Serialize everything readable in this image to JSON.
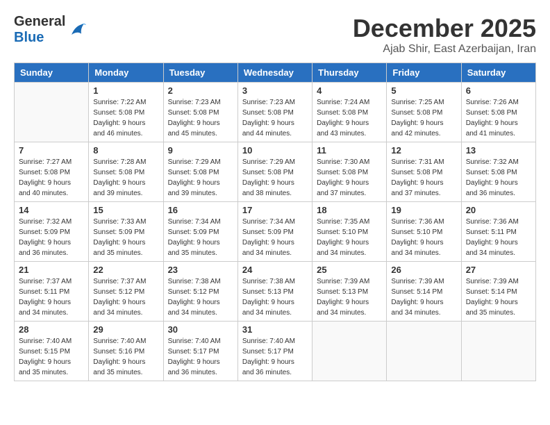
{
  "header": {
    "logo_line1": "General",
    "logo_line2": "Blue",
    "month_title": "December 2025",
    "subtitle": "Ajab Shir, East Azerbaijan, Iran"
  },
  "columns": [
    "Sunday",
    "Monday",
    "Tuesday",
    "Wednesday",
    "Thursday",
    "Friday",
    "Saturday"
  ],
  "weeks": [
    [
      {
        "day": "",
        "info": ""
      },
      {
        "day": "1",
        "info": "Sunrise: 7:22 AM\nSunset: 5:08 PM\nDaylight: 9 hours\nand 46 minutes."
      },
      {
        "day": "2",
        "info": "Sunrise: 7:23 AM\nSunset: 5:08 PM\nDaylight: 9 hours\nand 45 minutes."
      },
      {
        "day": "3",
        "info": "Sunrise: 7:23 AM\nSunset: 5:08 PM\nDaylight: 9 hours\nand 44 minutes."
      },
      {
        "day": "4",
        "info": "Sunrise: 7:24 AM\nSunset: 5:08 PM\nDaylight: 9 hours\nand 43 minutes."
      },
      {
        "day": "5",
        "info": "Sunrise: 7:25 AM\nSunset: 5:08 PM\nDaylight: 9 hours\nand 42 minutes."
      },
      {
        "day": "6",
        "info": "Sunrise: 7:26 AM\nSunset: 5:08 PM\nDaylight: 9 hours\nand 41 minutes."
      }
    ],
    [
      {
        "day": "7",
        "info": "Sunrise: 7:27 AM\nSunset: 5:08 PM\nDaylight: 9 hours\nand 40 minutes."
      },
      {
        "day": "8",
        "info": "Sunrise: 7:28 AM\nSunset: 5:08 PM\nDaylight: 9 hours\nand 39 minutes."
      },
      {
        "day": "9",
        "info": "Sunrise: 7:29 AM\nSunset: 5:08 PM\nDaylight: 9 hours\nand 39 minutes."
      },
      {
        "day": "10",
        "info": "Sunrise: 7:29 AM\nSunset: 5:08 PM\nDaylight: 9 hours\nand 38 minutes."
      },
      {
        "day": "11",
        "info": "Sunrise: 7:30 AM\nSunset: 5:08 PM\nDaylight: 9 hours\nand 37 minutes."
      },
      {
        "day": "12",
        "info": "Sunrise: 7:31 AM\nSunset: 5:08 PM\nDaylight: 9 hours\nand 37 minutes."
      },
      {
        "day": "13",
        "info": "Sunrise: 7:32 AM\nSunset: 5:08 PM\nDaylight: 9 hours\nand 36 minutes."
      }
    ],
    [
      {
        "day": "14",
        "info": "Sunrise: 7:32 AM\nSunset: 5:09 PM\nDaylight: 9 hours\nand 36 minutes."
      },
      {
        "day": "15",
        "info": "Sunrise: 7:33 AM\nSunset: 5:09 PM\nDaylight: 9 hours\nand 35 minutes."
      },
      {
        "day": "16",
        "info": "Sunrise: 7:34 AM\nSunset: 5:09 PM\nDaylight: 9 hours\nand 35 minutes."
      },
      {
        "day": "17",
        "info": "Sunrise: 7:34 AM\nSunset: 5:09 PM\nDaylight: 9 hours\nand 34 minutes."
      },
      {
        "day": "18",
        "info": "Sunrise: 7:35 AM\nSunset: 5:10 PM\nDaylight: 9 hours\nand 34 minutes."
      },
      {
        "day": "19",
        "info": "Sunrise: 7:36 AM\nSunset: 5:10 PM\nDaylight: 9 hours\nand 34 minutes."
      },
      {
        "day": "20",
        "info": "Sunrise: 7:36 AM\nSunset: 5:11 PM\nDaylight: 9 hours\nand 34 minutes."
      }
    ],
    [
      {
        "day": "21",
        "info": "Sunrise: 7:37 AM\nSunset: 5:11 PM\nDaylight: 9 hours\nand 34 minutes."
      },
      {
        "day": "22",
        "info": "Sunrise: 7:37 AM\nSunset: 5:12 PM\nDaylight: 9 hours\nand 34 minutes."
      },
      {
        "day": "23",
        "info": "Sunrise: 7:38 AM\nSunset: 5:12 PM\nDaylight: 9 hours\nand 34 minutes."
      },
      {
        "day": "24",
        "info": "Sunrise: 7:38 AM\nSunset: 5:13 PM\nDaylight: 9 hours\nand 34 minutes."
      },
      {
        "day": "25",
        "info": "Sunrise: 7:39 AM\nSunset: 5:13 PM\nDaylight: 9 hours\nand 34 minutes."
      },
      {
        "day": "26",
        "info": "Sunrise: 7:39 AM\nSunset: 5:14 PM\nDaylight: 9 hours\nand 34 minutes."
      },
      {
        "day": "27",
        "info": "Sunrise: 7:39 AM\nSunset: 5:14 PM\nDaylight: 9 hours\nand 35 minutes."
      }
    ],
    [
      {
        "day": "28",
        "info": "Sunrise: 7:40 AM\nSunset: 5:15 PM\nDaylight: 9 hours\nand 35 minutes."
      },
      {
        "day": "29",
        "info": "Sunrise: 7:40 AM\nSunset: 5:16 PM\nDaylight: 9 hours\nand 35 minutes."
      },
      {
        "day": "30",
        "info": "Sunrise: 7:40 AM\nSunset: 5:17 PM\nDaylight: 9 hours\nand 36 minutes."
      },
      {
        "day": "31",
        "info": "Sunrise: 7:40 AM\nSunset: 5:17 PM\nDaylight: 9 hours\nand 36 minutes."
      },
      {
        "day": "",
        "info": ""
      },
      {
        "day": "",
        "info": ""
      },
      {
        "day": "",
        "info": ""
      }
    ]
  ]
}
